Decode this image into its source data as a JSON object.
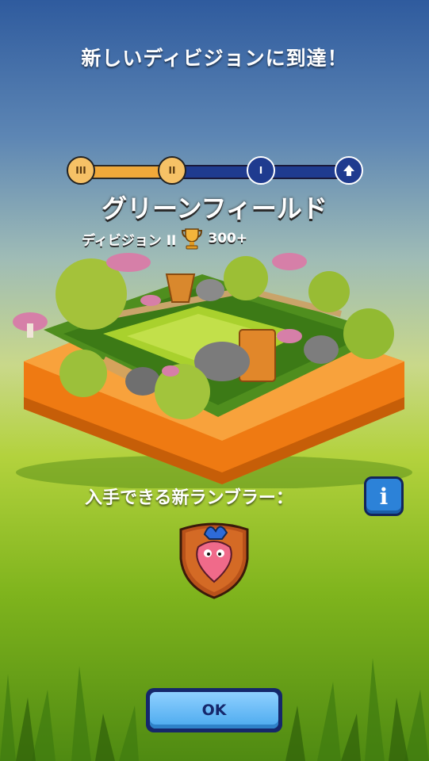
{
  "header": {
    "title": "新しいディビジョンに到達！"
  },
  "progress": {
    "nodes": [
      {
        "label": "III",
        "state": "done"
      },
      {
        "label": "II",
        "state": "done"
      },
      {
        "label": "I",
        "state": "todo"
      },
      {
        "label": "",
        "state": "top"
      }
    ]
  },
  "division": {
    "name": "グリーンフィールド",
    "sub_label": "ディビジョン II",
    "trophy_count": "300+"
  },
  "rumbler": {
    "label": "入手できる新ランブラー：",
    "info_label": "i"
  },
  "footer": {
    "ok_label": "OK"
  },
  "colors": {
    "accent_orange": "#f0a93a",
    "track_blue": "#1f3b8f",
    "button_blue": "#4aa9ee"
  }
}
